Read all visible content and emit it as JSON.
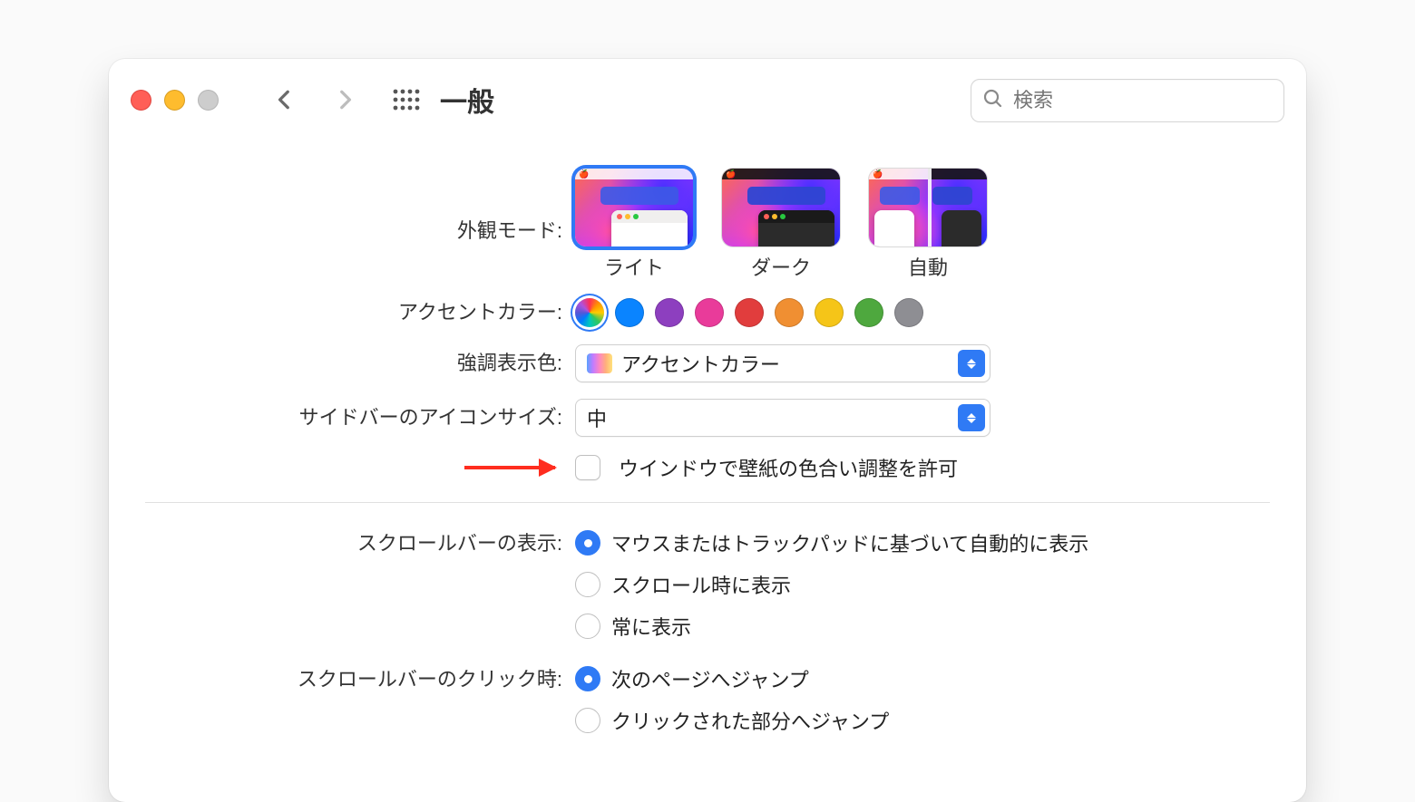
{
  "window": {
    "title": "一般",
    "search_placeholder": "検索"
  },
  "appearance": {
    "label": "外観モード:",
    "options": [
      "ライト",
      "ダーク",
      "自動"
    ],
    "selected": "ライト"
  },
  "accent": {
    "label": "アクセントカラー:",
    "swatches": [
      {
        "name": "multicolor",
        "color": "multi",
        "selected": true
      },
      {
        "name": "blue",
        "color": "#0a84ff"
      },
      {
        "name": "purple",
        "color": "#8d3fbf"
      },
      {
        "name": "pink",
        "color": "#e93b9a"
      },
      {
        "name": "red",
        "color": "#e13d3d"
      },
      {
        "name": "orange",
        "color": "#f08f32"
      },
      {
        "name": "yellow",
        "color": "#f5c518"
      },
      {
        "name": "green",
        "color": "#4ea83e"
      },
      {
        "name": "graphite",
        "color": "#8e8e93"
      }
    ]
  },
  "highlight": {
    "label": "強調表示色:",
    "value": "アクセントカラー"
  },
  "sidebar_icon_size": {
    "label": "サイドバーのアイコンサイズ:",
    "value": "中"
  },
  "wallpaper_tint": {
    "label": "ウインドウで壁紙の色合い調整を許可",
    "checked": false
  },
  "scrollbar_show": {
    "label": "スクロールバーの表示:",
    "options": [
      "マウスまたはトラックパッドに基づいて自動的に表示",
      "スクロール時に表示",
      "常に表示"
    ],
    "selected": 0
  },
  "scrollbar_click": {
    "label": "スクロールバーのクリック時:",
    "options": [
      "次のページへジャンプ",
      "クリックされた部分へジャンプ"
    ],
    "selected": 0
  }
}
